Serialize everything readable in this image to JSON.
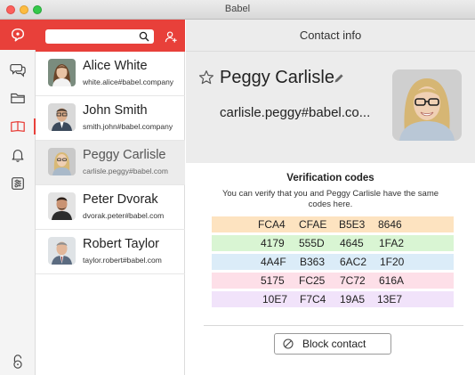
{
  "window": {
    "title": "Babel"
  },
  "sidebar": {
    "items": [
      {
        "icon": "babel-logo-icon",
        "active": true
      },
      {
        "icon": "chats-icon"
      },
      {
        "icon": "folder-icon"
      },
      {
        "icon": "contacts-book-icon",
        "selected": true
      },
      {
        "icon": "bell-icon"
      },
      {
        "icon": "settings-icon"
      },
      {
        "icon": "unlock-icon"
      }
    ]
  },
  "search": {
    "placeholder": "",
    "value": ""
  },
  "contacts": [
    {
      "name": "Alice White",
      "email": "white.alice#babel.company"
    },
    {
      "name": "John Smith",
      "email": "smith.john#babel.company"
    },
    {
      "name": "Peggy Carlisle",
      "email": "carlisle.peggy#babel.com",
      "selected": true
    },
    {
      "name": "Peter Dvorak",
      "email": "dvorak.peter#babel.com"
    },
    {
      "name": "Robert Taylor",
      "email": "taylor.robert#babel.com"
    }
  ],
  "detail": {
    "header_title": "Contact info",
    "name": "Peggy Carlisle",
    "email": "carlisle.peggy#babel.co...",
    "verification": {
      "title": "Verification codes",
      "description": "You can verify that you and Peggy Carlisle have the same codes here.",
      "rows": [
        {
          "codes": [
            "FCA4",
            "CFAE",
            "B5E3",
            "8646"
          ],
          "color": "#fde3c0"
        },
        {
          "codes": [
            "4179",
            "555D",
            "4645",
            "1FA2"
          ],
          "color": "#d9f5d3"
        },
        {
          "codes": [
            "4A4F",
            "B363",
            "6AC2",
            "1F20"
          ],
          "color": "#dbecf8"
        },
        {
          "codes": [
            "5175",
            "FC25",
            "7C72",
            "616A"
          ],
          "color": "#fddfe8"
        },
        {
          "codes": [
            "10E7",
            "F7C4",
            "19A5",
            "13E7"
          ],
          "color": "#f1e3fa"
        }
      ]
    },
    "block_button": "Block contact"
  },
  "colors": {
    "accent": "#e8403a",
    "panel": "#ececec"
  }
}
